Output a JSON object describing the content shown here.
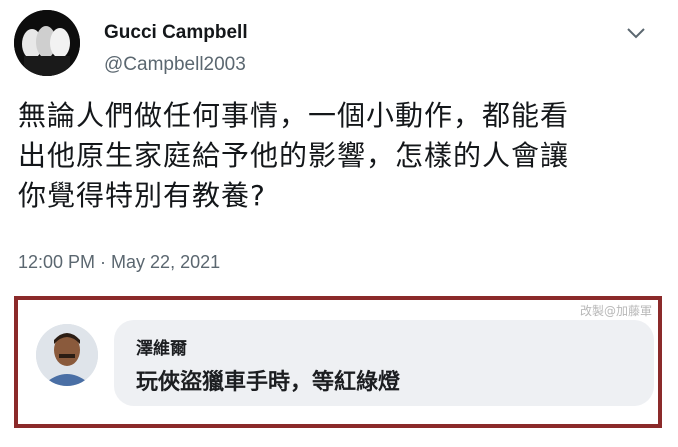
{
  "tweet": {
    "display_name": "Gucci Campbell",
    "handle": "@Campbell2003",
    "text_lines": [
      "無論人們做任何事情，一個小動作，都能看",
      "出他原生家庭給予他的影響，怎樣的人會讓",
      "你覺得特別有教養?"
    ],
    "timestamp": "12:00 PM · May 22, 2021",
    "menu_icon": "chevron-down-icon"
  },
  "reply": {
    "name": "澤維爾",
    "text": "玩俠盜獵車手時，等紅綠燈",
    "watermark": "改製@加藤軍"
  },
  "colors": {
    "frame": "#8b2a2a",
    "bubble": "#eef0f3",
    "secondary_text": "#5b6770"
  }
}
